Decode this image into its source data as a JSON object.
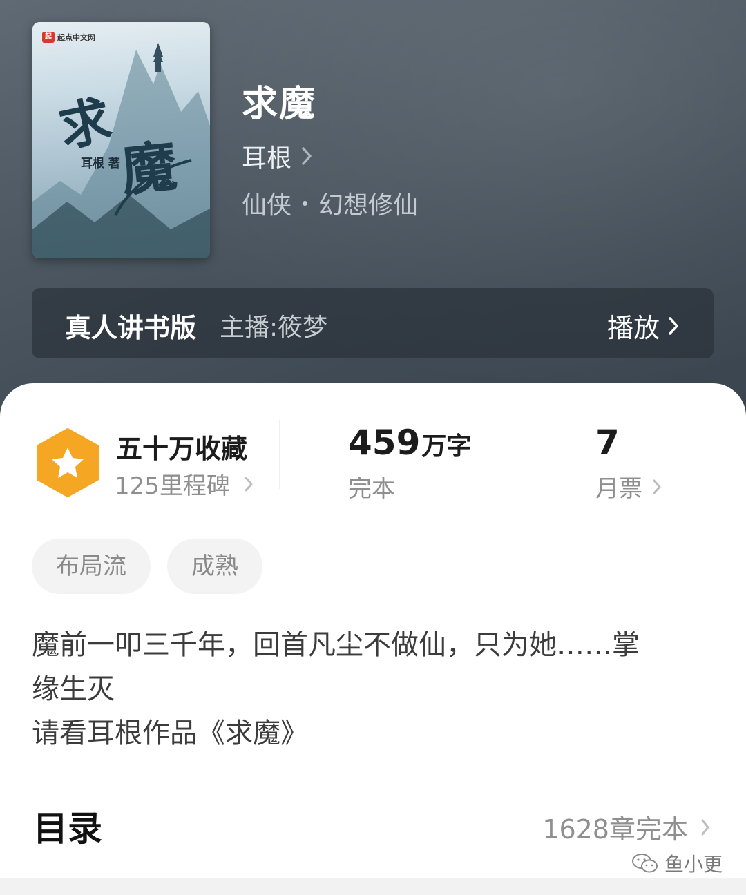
{
  "book": {
    "title": "求魔",
    "author": "耳根",
    "genre": "仙侠",
    "subgenre": "幻想修仙"
  },
  "cover": {
    "publisher_logo": "起",
    "publisher": "起点中文网",
    "title_char_1": "求",
    "title_char_2": "魔",
    "author_mark": "耳根 著"
  },
  "audio": {
    "label": "真人讲书版",
    "host": "主播:筱梦",
    "play_label": "播放"
  },
  "stats": {
    "collections": "五十万收藏",
    "milestones": "125里程碑",
    "word_count": "459",
    "word_unit": "万字",
    "status": "完本",
    "monthly_votes": "7",
    "monthly_votes_label": "月票"
  },
  "tags": [
    "布局流",
    "成熟"
  ],
  "synopsis": {
    "line1": "魔前一叩三千年，回首凡尘不做仙，只为她……掌",
    "line2": "缘生灭",
    "line3": "请看耳根作品《求魔》"
  },
  "toc": {
    "title": "目录",
    "info": "1628章完本"
  },
  "watermark": {
    "text": "鱼小更"
  },
  "colors": {
    "badge_orange": "#f5a623",
    "header_bg": "#4d5862"
  }
}
